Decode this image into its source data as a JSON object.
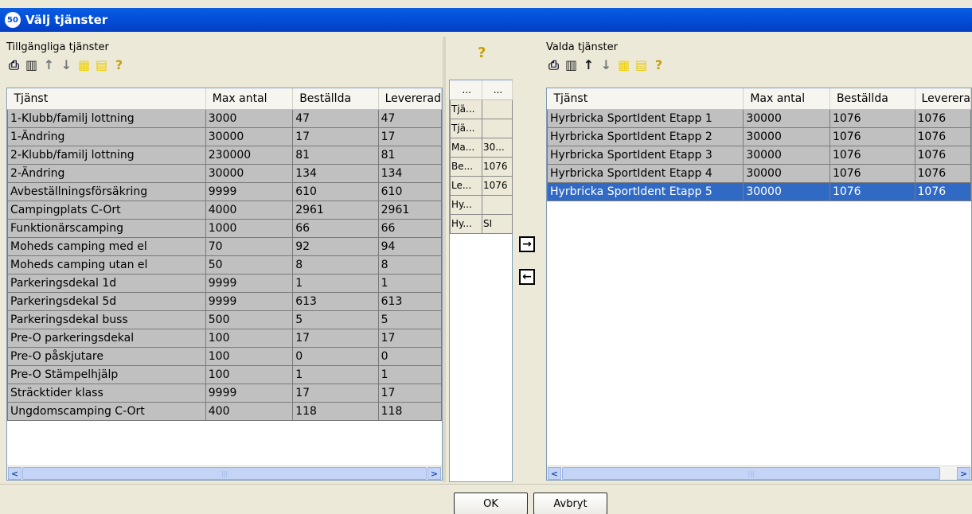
{
  "window": {
    "title": "Välj tjänster",
    "icon": "app-logo-icon"
  },
  "left_panel": {
    "label": "Tillgängliga tjänster",
    "toolbar": [
      "print-icon",
      "book-icon",
      "arrow-up-icon",
      "arrow-down-icon",
      "grid-icon",
      "columns-icon",
      "help-icon"
    ],
    "columns": [
      "Tjänst",
      "Max antal",
      "Beställda",
      "Levererad"
    ],
    "rows": [
      [
        "1-Klubb/familj lottning",
        "3000",
        "47",
        "47"
      ],
      [
        "1-Ändring",
        "30000",
        "17",
        "17"
      ],
      [
        "2-Klubb/familj lottning",
        "230000",
        "81",
        "81"
      ],
      [
        "2-Ändring",
        "30000",
        "134",
        "134"
      ],
      [
        "Avbeställningsförsäkring",
        "9999",
        "610",
        "610"
      ],
      [
        "Campingplats C-Ort",
        "4000",
        "2961",
        "2961"
      ],
      [
        "Funktionärscamping",
        "1000",
        "66",
        "66"
      ],
      [
        "Moheds camping med el",
        "70",
        "92",
        "94"
      ],
      [
        "Moheds camping utan el",
        "50",
        "8",
        "8"
      ],
      [
        "Parkeringsdekal 1d",
        "9999",
        "1",
        "1"
      ],
      [
        "Parkeringsdekal 5d",
        "9999",
        "613",
        "613"
      ],
      [
        "Parkeringsdekal buss",
        "500",
        "5",
        "5"
      ],
      [
        "Pre-O parkeringsdekal",
        "100",
        "17",
        "17"
      ],
      [
        "Pre-O påskjutare",
        "100",
        "0",
        "0"
      ],
      [
        "Pre-O Stämpelhjälp",
        "100",
        "1",
        "1"
      ],
      [
        "Sträcktider klass",
        "9999",
        "17",
        "17"
      ],
      [
        "Ungdomscamping C-Ort",
        "400",
        "118",
        "118"
      ]
    ]
  },
  "middle_panel": {
    "help_icon": "help-icon",
    "columns": [
      "...",
      "..."
    ],
    "rows": [
      [
        "Tjä...",
        ""
      ],
      [
        "Tjä...",
        ""
      ],
      [
        "Ma...",
        "30..."
      ],
      [
        "Be...",
        "1076"
      ],
      [
        "Le...",
        "1076"
      ],
      [
        "Hy...",
        ""
      ],
      [
        "Hy...",
        "SI"
      ]
    ],
    "move_right": "→",
    "move_left": "←"
  },
  "right_panel": {
    "label": "Valda tjänster",
    "toolbar": [
      "print-icon",
      "book-icon",
      "arrow-up-icon",
      "arrow-down-icon",
      "grid-icon",
      "columns-icon",
      "help-icon"
    ],
    "columns": [
      "Tjänst",
      "Max antal",
      "Beställda",
      "Leverera"
    ],
    "rows": [
      [
        "Hyrbricka SportIdent Etapp 1",
        "30000",
        "1076",
        "1076"
      ],
      [
        "Hyrbricka SportIdent Etapp 2",
        "30000",
        "1076",
        "1076"
      ],
      [
        "Hyrbricka SportIdent Etapp 3",
        "30000",
        "1076",
        "1076"
      ],
      [
        "Hyrbricka SportIdent Etapp 4",
        "30000",
        "1076",
        "1076"
      ],
      [
        "Hyrbricka SportIdent Etapp 5",
        "30000",
        "1076",
        "1076"
      ]
    ],
    "selected_row": 4
  },
  "buttons": {
    "ok": "OK",
    "cancel": "Avbryt"
  }
}
